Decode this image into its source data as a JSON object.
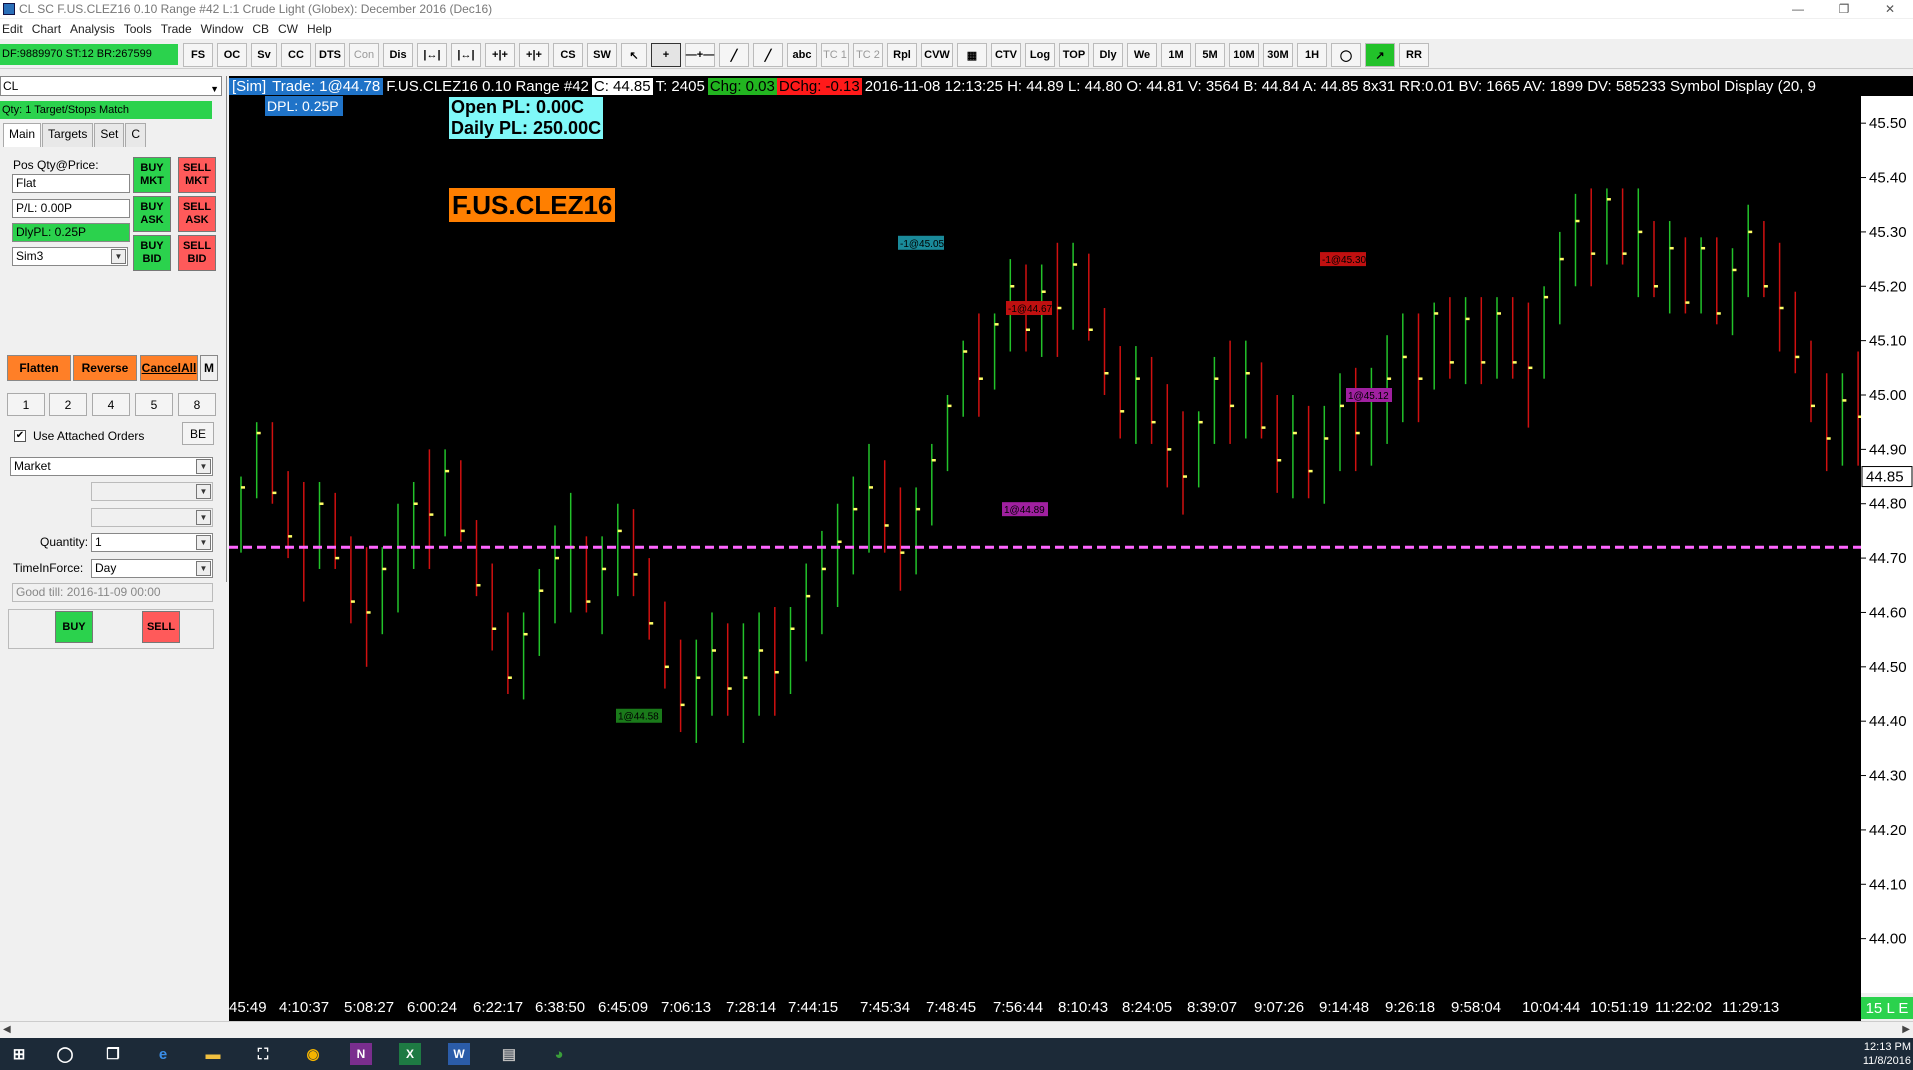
{
  "window": {
    "title": "CL  SC F.US.CLEZ16  0.10 Range  #42  L:1  Crude Light (Globex): December 2016 (Dec16)",
    "minimize": "—",
    "maximize": "❐",
    "close": "✕"
  },
  "menu": [
    "Edit",
    "Chart",
    "Analysis",
    "Tools",
    "Trade",
    "Window",
    "CB",
    "CW",
    "Help"
  ],
  "toolbar": {
    "account_status": "DF:9889970  ST:12  BR:267599",
    "buttons": [
      "FS",
      "OC",
      "Sv",
      "CC",
      "DTS",
      "Con",
      "Dis",
      "|↔|",
      "|↔|",
      "+|+",
      "+|+",
      "CS",
      "SW",
      "↖",
      "+",
      "—+—",
      "╱",
      "╱",
      "abc",
      "TC 1",
      "TC 2",
      "Rpl",
      "CVW",
      "▦",
      "CTV",
      "Log",
      "TOP",
      "Dly",
      "We",
      "1M",
      "5M",
      "10M",
      "30M",
      "1H",
      "◯",
      "↗",
      "RR"
    ],
    "disabled": [
      "Con",
      "TC 1",
      "TC 2"
    ]
  },
  "trade_panel": {
    "symbol": "CL",
    "target_match": "Qty: 1 Target/Stops Match",
    "tabs": [
      "Main",
      "Targets",
      "Set",
      "C"
    ],
    "pos_label": "Pos Qty@Price:",
    "position": "Flat",
    "pl": "P/L: 0.00P",
    "daily_pl": "DlyPL: 0.25P",
    "account": "Sim3",
    "buy_mkt": "BUY MKT",
    "sell_mkt": "SELL MKT",
    "buy_ask": "BUY ASK",
    "sell_ask": "SELL ASK",
    "buy_bid": "BUY BID",
    "sell_bid": "SELL BID",
    "flatten": "Flatten",
    "reverse": "Reverse",
    "cancel_all": "CancelAll",
    "m": "M",
    "qty_buttons": [
      "1",
      "2",
      "4",
      "5",
      "8"
    ],
    "use_attached_orders": "Use Attached Orders",
    "be": "BE",
    "order_type": "Market",
    "quantity_label": "Quantity:",
    "quantity": "1",
    "tif_label": "TimeInForce:",
    "tif": "Day",
    "good_till": "Good till: 2016-11-09 00:00",
    "buy": "BUY",
    "sell": "SELL",
    "dpl": "DPL: 0.25P"
  },
  "chart_header": {
    "sim": "[Sim]",
    "trade": "Trade: 1@44.78",
    "symbol_info": "F.US.CLEZ16  0.10 Range  #42",
    "close": "C: 44.85",
    "ticks": "T: 2405",
    "chg": "Chg: 0.03",
    "dchg": "DChg: -0.13",
    "details": "2016-11-08 12:13:25  H: 44.89  L: 44.80  O: 44.81  V: 3564  B: 44.84  A: 44.85  8x31  RR:0.01  BV: 1665  AV: 1899  DV: 585233  Symbol Display   (20, 9"
  },
  "overlay": {
    "open_pl": "Open PL: 0.00C",
    "daily_pl": "Daily PL: 250.00C",
    "symbol": "F.US.CLEZ16"
  },
  "colors": {
    "up": "#22c22a",
    "down": "#d01010",
    "tick": "#ffff66",
    "dashed_line": "#ff66ff",
    "background": "#000000"
  },
  "chart_data": {
    "type": "range bars (0.10 Range)",
    "ylim": [
      43.9,
      45.55
    ],
    "y_ticks": [
      "45.50",
      "45.40",
      "45.30",
      "45.20",
      "45.10",
      "45.00",
      "44.90",
      "44.80",
      "44.70",
      "44.60",
      "44.50",
      "44.40",
      "44.30",
      "44.20",
      "44.10",
      "44.00"
    ],
    "current_price": "44.85",
    "position_line": 44.72,
    "x_labels": [
      "45:49",
      "4:10:37",
      "5:08:27",
      "6:00:24",
      "6:22:17",
      "6:38:50",
      "6:45:09",
      "7:06:13",
      "7:28:14",
      "7:44:15",
      "7:45:34",
      "7:48:45",
      "7:56:44",
      "8:10:43",
      "8:24:05",
      "8:39:07",
      "9:07:26",
      "9:14:48",
      "9:26:18",
      "9:58:04",
      "10:04:44",
      "10:51:19",
      "11:22:02",
      "11:29:13"
    ],
    "closes": [
      44.83,
      44.93,
      44.82,
      44.74,
      44.72,
      44.8,
      44.7,
      44.62,
      44.6,
      44.68,
      44.72,
      44.8,
      44.78,
      44.86,
      44.75,
      44.65,
      44.57,
      44.48,
      44.56,
      44.64,
      44.7,
      44.72,
      44.62,
      44.68,
      44.75,
      44.67,
      44.58,
      44.5,
      44.43,
      44.48,
      44.53,
      44.46,
      44.48,
      44.53,
      44.49,
      44.57,
      44.63,
      44.68,
      44.73,
      44.79,
      44.83,
      44.76,
      44.71,
      44.79,
      44.88,
      44.98,
      45.08,
      45.03,
      45.13,
      45.2,
      45.12,
      45.19,
      45.16,
      45.24,
      45.12,
      45.04,
      44.97,
      45.03,
      44.95,
      44.9,
      44.85,
      44.95,
      45.03,
      44.98,
      45.04,
      44.94,
      44.88,
      44.93,
      44.86,
      44.92,
      44.98,
      44.93,
      44.99,
      45.03,
      45.07,
      45.03,
      45.15,
      45.06,
      45.14,
      45.06,
      45.15,
      45.06,
      45.05,
      45.18,
      45.25,
      45.32,
      45.26,
      45.36,
      45.26,
      45.3,
      45.2,
      45.27,
      45.17,
      45.27,
      45.15,
      45.23,
      45.3,
      45.2,
      45.16,
      45.07,
      44.98,
      44.92,
      44.99,
      44.96,
      45.01,
      44.96,
      45.0,
      44.94,
      44.9,
      44.84,
      44.85
    ],
    "trade_markers": [
      {
        "label": "-1@45.05",
        "price": 45.28,
        "color": "#1a8a9a"
      },
      {
        "label": "-1@44.67",
        "price": 45.16,
        "color": "#c01010"
      },
      {
        "label": "1@44.89",
        "price": 44.79,
        "color": "#a020a0"
      },
      {
        "label": "1@44.58",
        "price": 44.41,
        "color": "#1a7a1a"
      },
      {
        "label": "-1@45.30",
        "price": 45.25,
        "color": "#c01010"
      },
      {
        "label": "1@45.12",
        "price": 45.0,
        "color": "#a020a0"
      }
    ]
  },
  "timeframe_badge": "15 L E",
  "taskbar": {
    "time": "12:13 PM",
    "date": "11/8/2016"
  }
}
